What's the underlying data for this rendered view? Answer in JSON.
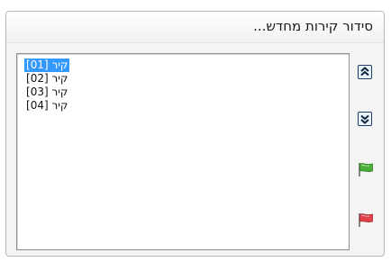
{
  "dialog": {
    "title": "סידור קירות מחדש..."
  },
  "walls_list": {
    "items": [
      {
        "label": "קיר [01]",
        "selected": true
      },
      {
        "label": "קיר [02]",
        "selected": false
      },
      {
        "label": "קיר [03]",
        "selected": false
      },
      {
        "label": "קיר [04]",
        "selected": false
      }
    ]
  },
  "toolbar": {
    "move_up_icon": "double-chevron-up-icon",
    "move_down_icon": "double-chevron-down-icon",
    "green_flag_icon": "green-flag-icon",
    "red_flag_icon": "red-flag-icon"
  },
  "colors": {
    "selection": "#3399ff",
    "green_flag": "#4caf3a",
    "red_flag": "#e0404a"
  }
}
